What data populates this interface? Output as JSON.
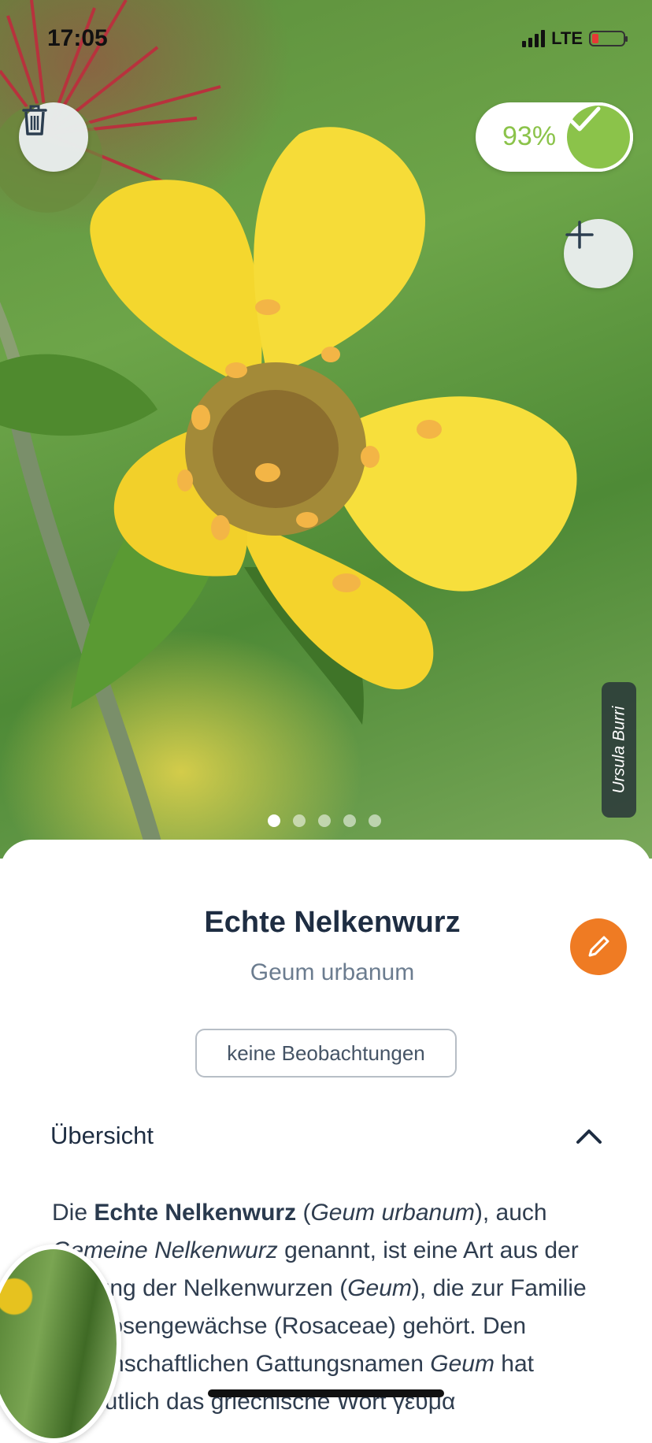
{
  "status_bar": {
    "time": "17:05",
    "network": "LTE"
  },
  "hero": {
    "photo_subject": "yellow Geum urbanum flower",
    "confidence": "93%",
    "photo_credit": "Ursula Burri",
    "carousel": {
      "count": 5,
      "active_index": 0
    },
    "icons": {
      "delete": "trash-icon",
      "add": "plus-icon",
      "confidence": "checkmark-icon"
    }
  },
  "species": {
    "common_name": "Echte Nelkenwurz",
    "latin_name": "Geum urbanum",
    "observations_label": "keine Beobachtungen"
  },
  "overview": {
    "title": "Übersicht",
    "p1_a": "Die ",
    "p1_b": "Echte Nelkenwurz",
    "p1_c": " (",
    "p1_d": "Geum urbanum",
    "p1_e": "), auch ",
    "p1_f": "Gemeine Nelkenwurz",
    "p1_g": " genannt, ist eine Art aus der Gattung der Nelkenwurzen (",
    "p1_h": "Geum",
    "p1_i": "), die zur Familie der Rosengewächse (Rosaceae) gehört. Den wissenschaftlichen Gattungsnamen ",
    "p1_j": "Geum",
    "p1_k": " hat vermutlich das griechische Wort γεῦμα"
  },
  "colors": {
    "accent_orange": "#ef7b23",
    "confidence_green": "#8bc34a",
    "title_navy": "#1e2d42"
  }
}
